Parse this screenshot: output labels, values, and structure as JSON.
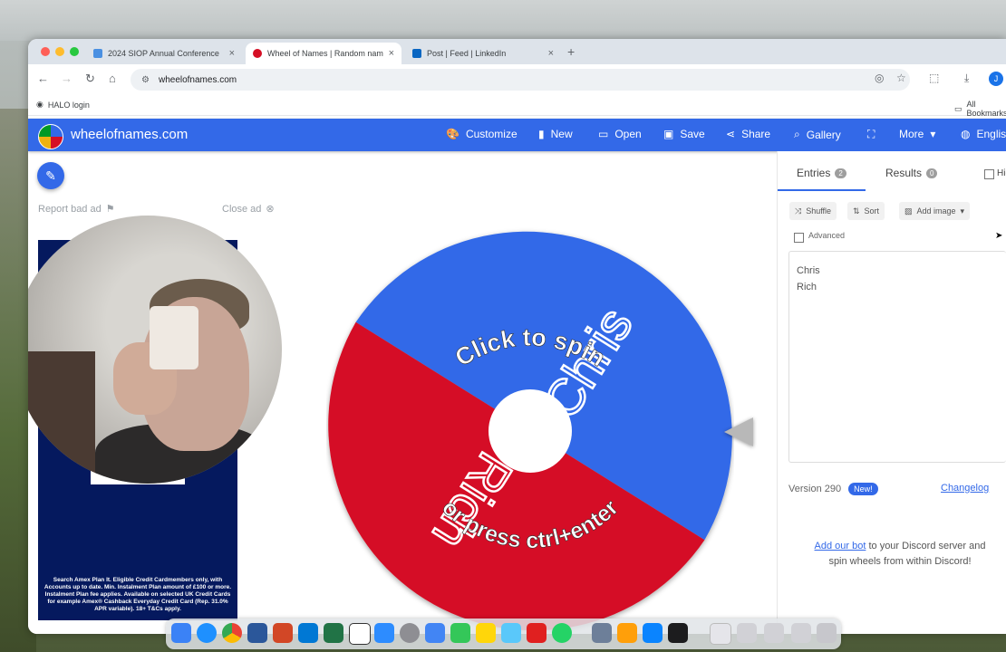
{
  "browser": {
    "tabs": [
      {
        "title": "2024 SIOP Annual Conference",
        "favicon_color": "#4a90e2"
      },
      {
        "title": "Wheel of Names | Random name picker",
        "favicon_color": "#d50f25"
      },
      {
        "title": "Post | Feed | LinkedIn",
        "favicon_color": "#0a66c2"
      }
    ],
    "url": "wheelofnames.com",
    "profile_initial": "J",
    "bookmarks": {
      "left": "HALO login",
      "right": "All Bookmarks"
    }
  },
  "site": {
    "brand": "wheelofnames.com",
    "nav": {
      "customize": "Customize",
      "new": "New",
      "open": "Open",
      "save": "Save",
      "share": "Share",
      "gallery": "Gallery",
      "more": "More",
      "language": "English"
    },
    "ad": {
      "report": "Report bad ad",
      "close": "Close ad",
      "disclaimer": "Search Amex Plan It. Eligible Credit Cardmembers only, with Accounts up to date. Min. Instalment Plan amount of £100 or more. Instalment Plan fee applies. Available on selected UK Credit Cards for example Amex® Cashback Everyday Credit Card (Rep. 31.0% APR variable). 18+ T&Cs apply."
    },
    "wheel": {
      "click_text": "Click to spin",
      "press_text": "or press ctrl+enter",
      "segments": [
        {
          "name": "Chris",
          "color": "#3369e8"
        },
        {
          "name": "Rich",
          "color": "#d50f25"
        }
      ]
    },
    "panel": {
      "entries_tab": "Entries",
      "entries_count": "2",
      "results_tab": "Results",
      "results_count": "0",
      "hide_label": "Hide",
      "shuffle": "Shuffle",
      "sort": "Sort",
      "add_image": "Add image",
      "advanced": "Advanced",
      "entries": [
        "Chris",
        "Rich"
      ],
      "version": "Version 290",
      "new_badge": "New!",
      "changelog": "Changelog",
      "discord_link": "Add our bot",
      "discord_text": " to your Discord server and spin wheels from within Discord!"
    }
  },
  "icons": {
    "edit": "pencil-icon",
    "customize": "palette-icon",
    "new": "file-icon",
    "open": "folder-icon",
    "save": "floppy-icon",
    "share": "share-icon",
    "gallery": "search-icon",
    "fullscreen": "fullscreen-icon",
    "language": "globe-icon"
  }
}
